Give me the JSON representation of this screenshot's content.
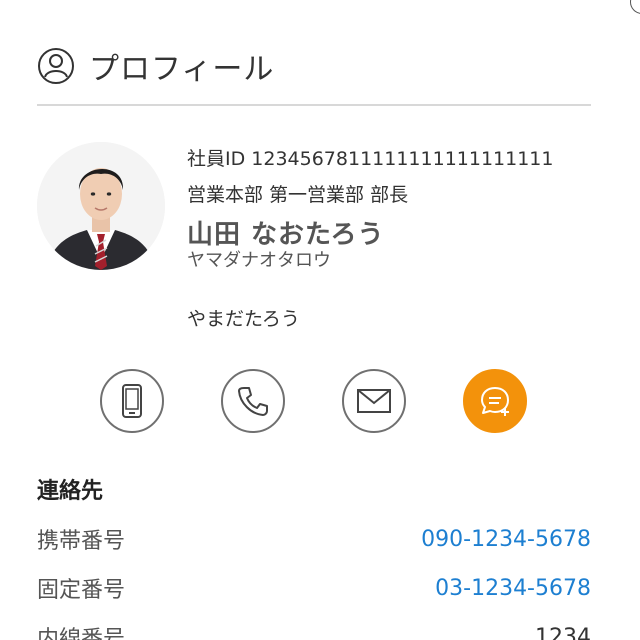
{
  "header": {
    "title": "プロフィール",
    "icon": "user-circle-icon"
  },
  "profile": {
    "employee_id": "社員ID 1234567811111111111111111",
    "department": "営業本部 第一営業部 部長",
    "name": "山田 なおたろう",
    "name_kana": "ヤマダナオタロウ",
    "name_hiragana": "やまだたろう",
    "avatar": "profile-photo"
  },
  "actions": [
    {
      "icon": "mobile-phone-icon"
    },
    {
      "icon": "phone-icon"
    },
    {
      "icon": "mail-icon"
    },
    {
      "icon": "chat-add-icon",
      "color": "#f3920b"
    }
  ],
  "contacts": {
    "title": "連絡先",
    "rows": [
      {
        "label": "携帯番号",
        "value": "090-1234-5678",
        "link": true
      },
      {
        "label": "固定番号",
        "value": "03-1234-5678",
        "link": true
      },
      {
        "label": "内線番号",
        "value": "1234",
        "link": false
      }
    ]
  },
  "colors": {
    "accent": "#f3920b",
    "link": "#1d7fd1",
    "divider": "#d8d8d8"
  }
}
